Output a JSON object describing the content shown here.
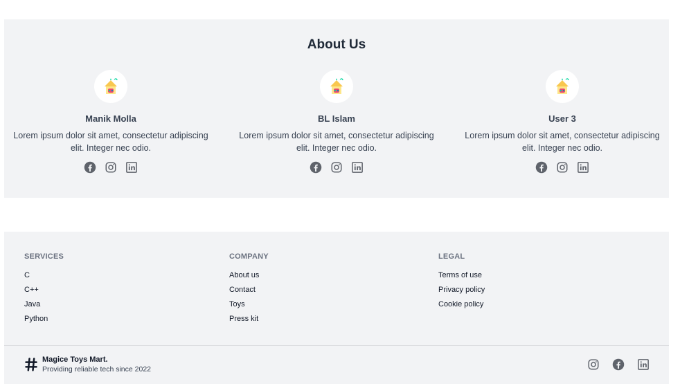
{
  "about": {
    "title": "About Us",
    "members": [
      {
        "name": "Manik Molla",
        "bio": "Lorem ipsum dolor sit amet, consectetur adipiscing elit. Integer nec odio."
      },
      {
        "name": "BL Islam",
        "bio": "Lorem ipsum dolor sit amet, consectetur adipiscing elit. Integer nec odio."
      },
      {
        "name": "User 3",
        "bio": "Lorem ipsum dolor sit amet, consectetur adipiscing elit. Integer nec odio."
      }
    ],
    "social_icons": [
      "facebook-icon",
      "instagram-icon",
      "linkedin-icon"
    ]
  },
  "footer": {
    "columns": [
      {
        "heading": "SERVICES",
        "links": [
          "C",
          "C++",
          "Java",
          "Python"
        ]
      },
      {
        "heading": "COMPANY",
        "links": [
          "About us",
          "Contact",
          "Toys",
          "Press kit"
        ]
      },
      {
        "heading": "LEGAL",
        "links": [
          "Terms of use",
          "Privacy policy",
          "Cookie policy"
        ]
      }
    ],
    "brand": {
      "name": "Magice Toys Mart.",
      "tagline": "Providing reliable tech since 2022",
      "logo_icon": "hash-icon"
    },
    "social_icons": [
      "instagram-icon",
      "facebook-icon",
      "linkedin-icon"
    ]
  },
  "colors": {
    "section_bg": "#f2f3f5",
    "icon_gray": "#5f636b",
    "text_dark": "#1f2937"
  }
}
